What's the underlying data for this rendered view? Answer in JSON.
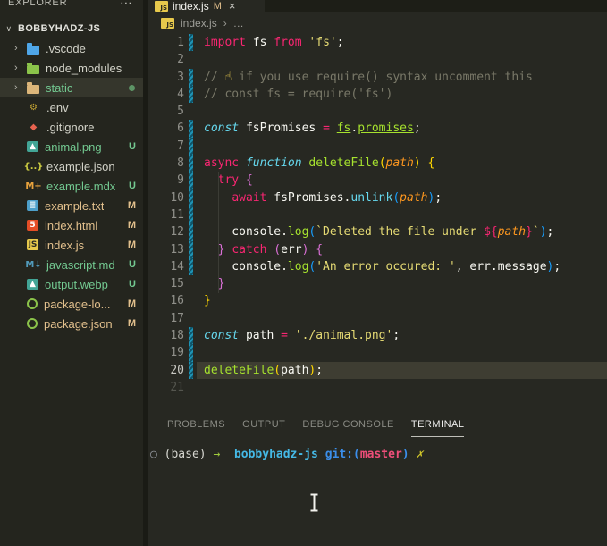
{
  "colors": {
    "untracked": "#73c991",
    "modified": "#e2c08d",
    "gutter_modified": "#1f93b4",
    "selection_bg": "#35362c",
    "accent_yellow": "#e7c94c"
  },
  "explorer": {
    "title": "EXPLORER",
    "menu_icon": "⋯",
    "section": {
      "chevron": "∨",
      "name": "BOBBYHADZ-JS"
    },
    "items": [
      {
        "label": ".vscode",
        "kind": "folder",
        "chevron": "›",
        "icon": {
          "shape": "folder",
          "color": "#4fa6e8"
        },
        "status": "none"
      },
      {
        "label": "node_modules",
        "kind": "folder",
        "chevron": "›",
        "icon": {
          "shape": "folder",
          "color": "#8bc34a"
        },
        "status": "none"
      },
      {
        "label": "static",
        "kind": "folder",
        "chevron": "›",
        "icon": {
          "shape": "folder",
          "color": "#dcb67a"
        },
        "status": "untracked",
        "selected": true,
        "dot": true
      },
      {
        "label": ".env",
        "kind": "file",
        "icon": {
          "shape": "text",
          "glyph": "⚙",
          "color": "#c7a634"
        },
        "status": "none"
      },
      {
        "label": ".gitignore",
        "kind": "file",
        "icon": {
          "shape": "text",
          "glyph": "◆",
          "color": "#e8634f"
        },
        "status": "none"
      },
      {
        "label": "animal.png",
        "kind": "file",
        "icon": {
          "shape": "chip",
          "glyph": "▲",
          "color": "#ffffff",
          "bg": "#42a596"
        },
        "status": "untracked",
        "badge": "U"
      },
      {
        "label": "example.json",
        "kind": "file",
        "icon": {
          "shape": "text",
          "glyph": "{..}",
          "color": "#cbcb41"
        },
        "status": "none"
      },
      {
        "label": "example.mdx",
        "kind": "file",
        "icon": {
          "shape": "text",
          "glyph": "M+",
          "color": "#e8a33d"
        },
        "status": "untracked",
        "badge": "U"
      },
      {
        "label": "example.txt",
        "kind": "file",
        "icon": {
          "shape": "chip",
          "glyph": "≣",
          "color": "#ffffff",
          "bg": "#4d9fca"
        },
        "status": "modified",
        "badge": "M"
      },
      {
        "label": "index.html",
        "kind": "file",
        "icon": {
          "shape": "chip",
          "glyph": "5",
          "color": "#ffffff",
          "bg": "#e44d26"
        },
        "status": "modified",
        "badge": "M"
      },
      {
        "label": "index.js",
        "kind": "file",
        "icon": {
          "shape": "chip",
          "glyph": "JS",
          "color": "#2b2b22",
          "bg": "#e7c94c"
        },
        "status": "modified",
        "badge": "M"
      },
      {
        "label": "javascript.md",
        "kind": "file",
        "icon": {
          "shape": "text",
          "glyph": "M↓",
          "color": "#519aba"
        },
        "status": "untracked",
        "badge": "U"
      },
      {
        "label": "output.webp",
        "kind": "file",
        "icon": {
          "shape": "chip",
          "glyph": "▲",
          "color": "#ffffff",
          "bg": "#42a596"
        },
        "status": "untracked",
        "badge": "U"
      },
      {
        "label": "package-lo...",
        "kind": "file",
        "icon": {
          "shape": "ring",
          "glyph": "",
          "color": "#8bc34a"
        },
        "status": "modified",
        "badge": "M"
      },
      {
        "label": "package.json",
        "kind": "file",
        "icon": {
          "shape": "ring",
          "glyph": "",
          "color": "#8bc34a"
        },
        "status": "modified",
        "badge": "M"
      }
    ]
  },
  "editor": {
    "tab": {
      "icon_glyph": "JS",
      "label": "index.js",
      "modified_indicator": "M",
      "close": "×"
    },
    "breadcrumb": {
      "icon_glyph": "JS",
      "file": "index.js",
      "separator": "›",
      "more": "…"
    },
    "code": {
      "active_line": 20,
      "dim_line": 21,
      "lines": [
        {
          "n": 1,
          "mod": true,
          "tokens": [
            [
              "kw",
              "import"
            ],
            [
              "txt",
              " fs "
            ],
            [
              "kw",
              "from"
            ],
            [
              "txt",
              " "
            ],
            [
              "str",
              "'fs'"
            ],
            [
              "txt",
              ";"
            ]
          ]
        },
        {
          "n": 2,
          "mod": false,
          "tokens": []
        },
        {
          "n": 3,
          "mod": true,
          "tokens": [
            [
              "cmt",
              "// "
            ],
            [
              "emoji",
              "☝"
            ],
            [
              "cmt",
              " if you use require() syntax uncomment this"
            ]
          ]
        },
        {
          "n": 4,
          "mod": true,
          "tokens": [
            [
              "cmt",
              "// const fs = require('fs')"
            ]
          ]
        },
        {
          "n": 5,
          "mod": false,
          "tokens": []
        },
        {
          "n": 6,
          "mod": true,
          "tokens": [
            [
              "kwi",
              "const"
            ],
            [
              "txt",
              " fsPromises "
            ],
            [
              "kw",
              "="
            ],
            [
              "txt",
              " "
            ],
            [
              "fnu",
              "fs"
            ],
            [
              "txt",
              "."
            ],
            [
              "fnu",
              "promises"
            ],
            [
              "txt",
              ";"
            ]
          ]
        },
        {
          "n": 7,
          "mod": true,
          "tokens": []
        },
        {
          "n": 8,
          "mod": true,
          "tokens": [
            [
              "kw",
              "async"
            ],
            [
              "txt",
              " "
            ],
            [
              "kwi",
              "function"
            ],
            [
              "txt",
              " "
            ],
            [
              "fn",
              "deleteFile"
            ],
            [
              "b1",
              "("
            ],
            [
              "par",
              "path"
            ],
            [
              "b1",
              ")"
            ],
            [
              "txt",
              " "
            ],
            [
              "b1",
              "{"
            ]
          ]
        },
        {
          "n": 9,
          "mod": true,
          "tokens": [
            [
              "txt",
              "  "
            ],
            [
              "kw",
              "try"
            ],
            [
              "txt",
              " "
            ],
            [
              "b2",
              "{"
            ]
          ]
        },
        {
          "n": 10,
          "mod": true,
          "tokens": [
            [
              "txt",
              "    "
            ],
            [
              "kw",
              "await"
            ],
            [
              "txt",
              " fsPromises."
            ],
            [
              "lib",
              "unlink"
            ],
            [
              "b3",
              "("
            ],
            [
              "par",
              "path"
            ],
            [
              "b3",
              ")"
            ],
            [
              "txt",
              ";"
            ]
          ]
        },
        {
          "n": 11,
          "mod": true,
          "tokens": []
        },
        {
          "n": 12,
          "mod": true,
          "tokens": [
            [
              "txt",
              "    console."
            ],
            [
              "fn",
              "log"
            ],
            [
              "b3",
              "("
            ],
            [
              "str",
              "`Deleted the file under "
            ],
            [
              "tpl",
              "${"
            ],
            [
              "par",
              "path"
            ],
            [
              "tpl",
              "}"
            ],
            [
              "str",
              "`"
            ],
            [
              "b3",
              ")"
            ],
            [
              "txt",
              ";"
            ]
          ]
        },
        {
          "n": 13,
          "mod": true,
          "tokens": [
            [
              "txt",
              "  "
            ],
            [
              "b2",
              "}"
            ],
            [
              "txt",
              " "
            ],
            [
              "kw",
              "catch"
            ],
            [
              "txt",
              " "
            ],
            [
              "b2",
              "("
            ],
            [
              "txt",
              "err"
            ],
            [
              "b2",
              ")"
            ],
            [
              "txt",
              " "
            ],
            [
              "b2",
              "{"
            ]
          ]
        },
        {
          "n": 14,
          "mod": true,
          "tokens": [
            [
              "txt",
              "    console."
            ],
            [
              "fn",
              "log"
            ],
            [
              "b3",
              "("
            ],
            [
              "str",
              "'An error occured: '"
            ],
            [
              "txt",
              ", err.message"
            ],
            [
              "b3",
              ")"
            ],
            [
              "txt",
              ";"
            ]
          ]
        },
        {
          "n": 15,
          "mod": false,
          "tokens": [
            [
              "txt",
              "  "
            ],
            [
              "b2",
              "}"
            ]
          ]
        },
        {
          "n": 16,
          "mod": false,
          "tokens": [
            [
              "b1",
              "}"
            ]
          ]
        },
        {
          "n": 17,
          "mod": false,
          "tokens": []
        },
        {
          "n": 18,
          "mod": true,
          "tokens": [
            [
              "kwi",
              "const"
            ],
            [
              "txt",
              " path "
            ],
            [
              "kw",
              "="
            ],
            [
              "txt",
              " "
            ],
            [
              "str",
              "'./animal.png'"
            ],
            [
              "txt",
              ";"
            ]
          ]
        },
        {
          "n": 19,
          "mod": true,
          "tokens": []
        },
        {
          "n": 20,
          "mod": true,
          "tokens": [
            [
              "fn",
              "deleteFile"
            ],
            [
              "b1",
              "("
            ],
            [
              "txt",
              "path"
            ],
            [
              "b1",
              ")"
            ],
            [
              "txt",
              ";"
            ]
          ]
        },
        {
          "n": 21,
          "mod": false,
          "tokens": []
        }
      ]
    }
  },
  "panel": {
    "tabs": [
      {
        "label": "PROBLEMS",
        "active": false
      },
      {
        "label": "OUTPUT",
        "active": false
      },
      {
        "label": "DEBUG CONSOLE",
        "active": false
      },
      {
        "label": "TERMINAL",
        "active": true
      }
    ],
    "terminal_prompt": [
      [
        "circ",
        "○ "
      ],
      [
        "env",
        "(base) "
      ],
      [
        "arr",
        "→  "
      ],
      [
        "dir",
        "bobbyhadz-js "
      ],
      [
        "git",
        "git:("
      ],
      [
        "branch",
        "master"
      ],
      [
        "git",
        ")"
      ],
      [
        "dirty",
        " ✗"
      ]
    ]
  }
}
